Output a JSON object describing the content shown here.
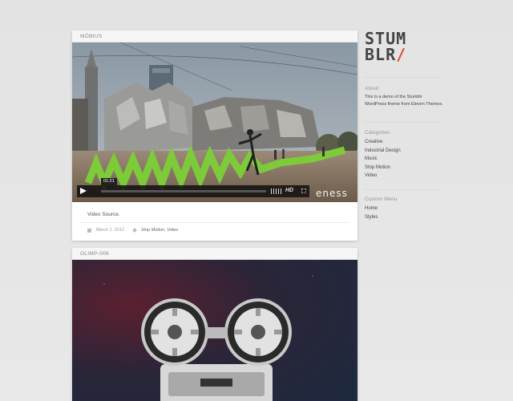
{
  "posts": [
    {
      "title": "MÖBIUS",
      "video": {
        "time": "01:21",
        "hd_label": "HD",
        "brand": "eness",
        "progress": 0.0
      },
      "caption": "Video Source.",
      "date": "March 1, 2012",
      "tags": "Stop Motion, Video"
    },
    {
      "title": "OLIMP-006"
    }
  ],
  "logo": {
    "line1": "STUM",
    "line2": "BLR",
    "slash": "/"
  },
  "sidebar": {
    "about": {
      "heading": "About",
      "text": "This is a demo of the Stumblr WordPress theme from Eleven Themes."
    },
    "categories": {
      "heading": "Categories",
      "items": [
        "Creative",
        "Industrial Design",
        "Music",
        "Stop Motion",
        "Video"
      ]
    },
    "custom_menu": {
      "heading": "Custom Menu",
      "items": [
        "Home",
        "Styles"
      ]
    }
  },
  "colors": {
    "background": "#e6e6e6",
    "accent": "#e24b2d",
    "green_installation": "#7ecb3a"
  },
  "icons": {
    "play": "play-icon",
    "volume": "volume-icon",
    "fullscreen": "fullscreen-icon",
    "calendar": "calendar-icon",
    "tag": "tag-icon"
  }
}
